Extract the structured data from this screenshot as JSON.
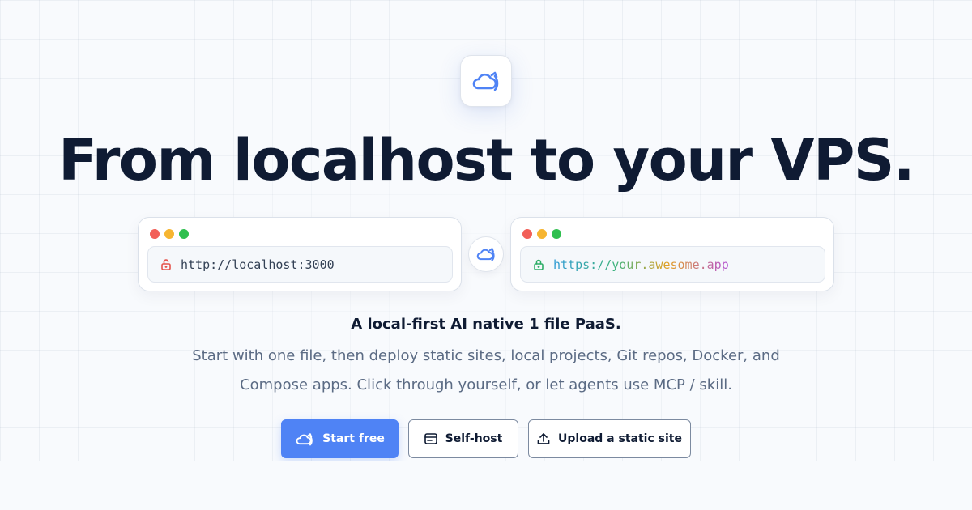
{
  "hero": {
    "headline": "From localhost to your VPS.",
    "tagline": "A local-first AI native 1 file PaaS.",
    "description": "Start with one file, then deploy static sites, local projects, Git repos, Docker, and Compose apps. Click through yourself, or let agents use MCP / skill."
  },
  "logo": {
    "icon": "cloud-upload-icon"
  },
  "source_window": {
    "url": "http://localhost:3000",
    "lock_color": "#e5534b"
  },
  "target_window": {
    "url": "https://your.awesome.app",
    "lock_color": "#2fae68"
  },
  "buttons": {
    "start": {
      "label": "Start free",
      "icon": "cloud-upload-icon"
    },
    "selfhost": {
      "label": "Self-host",
      "icon": "server-icon"
    },
    "upload": {
      "label": "Upload a static site",
      "icon": "upload-icon"
    }
  },
  "colors": {
    "accent": "#4f83f5",
    "heading": "#0f1b33",
    "body_text": "#5b6b84"
  }
}
